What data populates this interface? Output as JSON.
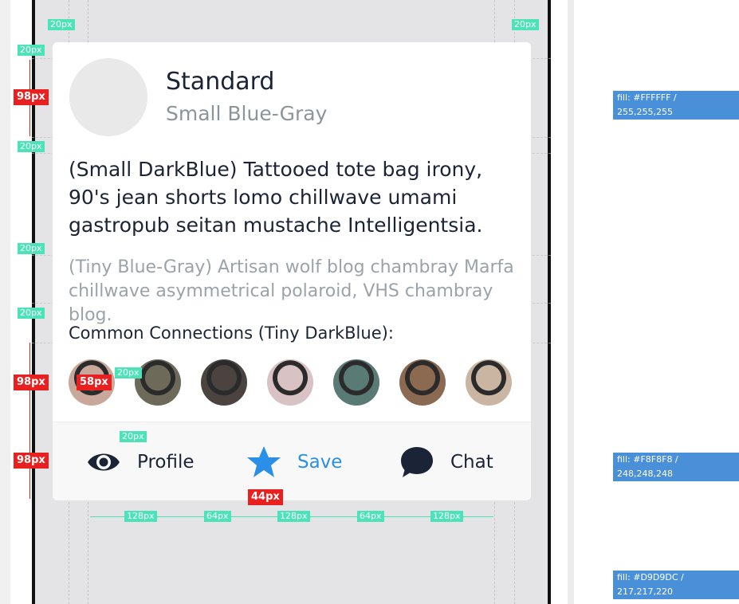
{
  "card": {
    "title": "Standard",
    "subtitle": "Small Blue-Gray",
    "body_text": "(Small DarkBlue) Tattooed tote bag irony, 90's jean shorts lomo chillwave umami gastropub seitan mustache Intelligentsia.",
    "meta_text": "(Tiny Blue-Gray) Artisan wolf blog chambray Marfa chillwave asymmetrical polaroid, VHS chambray blog.",
    "connections_label": "Common Connections (Tiny DarkBlue):",
    "connections": [
      {
        "name": "connection-1",
        "color": "#c9a79a"
      },
      {
        "name": "connection-2",
        "color": "#6d6a5a"
      },
      {
        "name": "connection-3",
        "color": "#4a4340"
      },
      {
        "name": "connection-4",
        "color": "#d8c2c4"
      },
      {
        "name": "connection-5",
        "color": "#5a7a76"
      },
      {
        "name": "connection-6",
        "color": "#8c6a52"
      },
      {
        "name": "connection-7",
        "color": "#c9b5a1"
      }
    ],
    "actions": [
      {
        "label": "Profile",
        "icon": "eye-icon",
        "color": "#1b2436"
      },
      {
        "label": "Save",
        "icon": "star-icon",
        "color": "#2a8fe6"
      },
      {
        "label": "Chat",
        "icon": "chat-bubble-icon",
        "color": "#1b2436"
      }
    ]
  },
  "annotations": {
    "spacing_20": "20px",
    "spacing_98": "98px",
    "spacing_58": "58px",
    "spacing_44": "44px",
    "spacing_128": "128px",
    "spacing_64": "64px"
  },
  "fills": {
    "card": "fill: #FFFFFF / 255,255,255",
    "actions": "fill: #F8F8F8 / 248,248,248",
    "background": "fill: #D9D9DC / 217,217,220"
  },
  "colors": {
    "dark_blue": "#1b2436",
    "blue_gray": "#8b959c",
    "accent_blue": "#2a8fe6",
    "measure_green": "#4de3b8",
    "measure_red": "#e8201f"
  }
}
